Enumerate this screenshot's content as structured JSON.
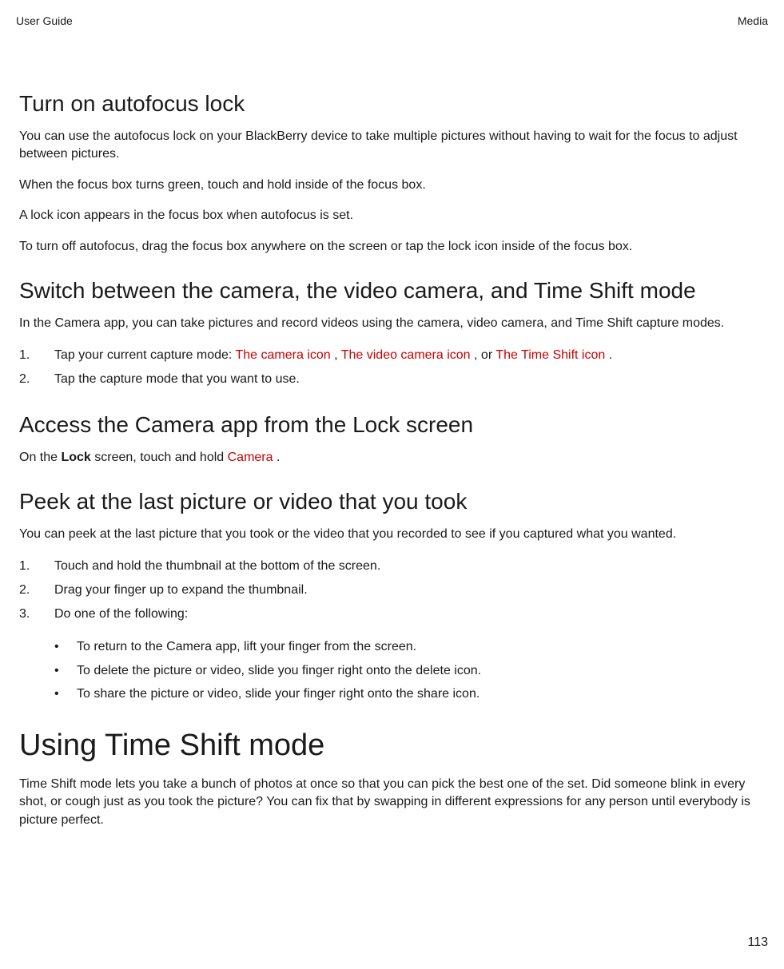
{
  "header": {
    "left": "User Guide",
    "right": "Media"
  },
  "section1": {
    "heading": "Turn on autofocus lock",
    "p1": "You can use the autofocus lock on your BlackBerry device to take multiple pictures without having to wait for the focus to adjust between pictures.",
    "p2": "When the focus box turns green, touch and hold inside of the focus box.",
    "p3": "A lock icon appears in the focus box when autofocus is set.",
    "p4": "To turn off autofocus, drag the focus box anywhere on the screen or tap the lock icon inside of the focus box."
  },
  "section2": {
    "heading": "Switch between the camera, the video camera, and Time Shift mode",
    "p1": "In the Camera app, you can take pictures and record videos using the camera, video camera, and Time Shift capture modes.",
    "li1_pre": "Tap your current capture mode: ",
    "li1_red1": " The camera icon ",
    "li1_sep1": ", ",
    "li1_red2": " The video camera icon ",
    "li1_sep2": ", or ",
    "li1_red3": " The Time Shift icon ",
    "li1_end": ".",
    "li2": "Tap the capture mode that you want to use."
  },
  "section3": {
    "heading": "Access the Camera app from the Lock screen",
    "p1_pre": "On the ",
    "p1_bold": "Lock",
    "p1_mid": " screen, touch and hold ",
    "p1_red": " Camera ",
    "p1_end": "."
  },
  "section4": {
    "heading": "Peek at the last picture or video that you took",
    "p1": "You can peek at the last picture that you took or the video that you recorded to see if you captured what you wanted.",
    "li1": "Touch and hold the thumbnail at the bottom of the screen.",
    "li2": "Drag your finger up to expand the thumbnail.",
    "li3": "Do one of the following:",
    "bul1": "To return to the Camera app, lift your finger from the screen.",
    "bul2": "To delete the picture or video, slide you finger right onto the delete icon.",
    "bul3": "To share the picture or video, slide your finger right onto the share icon."
  },
  "section5": {
    "heading": "Using Time Shift mode",
    "p1": "Time Shift mode lets you take a bunch of photos at once so that you can pick the best one of the set. Did someone blink in every shot, or cough just as you took the picture? You can fix that by swapping in different expressions for any person until everybody is picture perfect."
  },
  "pageNumber": "113"
}
